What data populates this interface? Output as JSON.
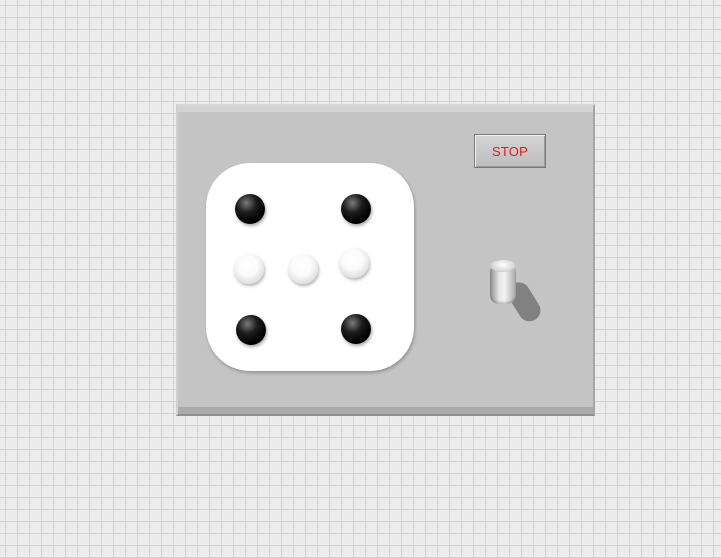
{
  "stop_button": {
    "label": "STOP",
    "label_color": "#e8141a"
  },
  "dice": {
    "face_color": "#ffffff",
    "lit_pip_color": "#000000",
    "unlit_pip_color": "#ffffff",
    "pips": [
      {
        "id": "top-left",
        "lit": true
      },
      {
        "id": "top-right",
        "lit": true
      },
      {
        "id": "middle-left",
        "lit": false
      },
      {
        "id": "center",
        "lit": false
      },
      {
        "id": "middle-right",
        "lit": false
      },
      {
        "id": "bottom-left",
        "lit": true
      },
      {
        "id": "bottom-right",
        "lit": true
      }
    ]
  },
  "toggle_switch": {
    "state": "up"
  }
}
